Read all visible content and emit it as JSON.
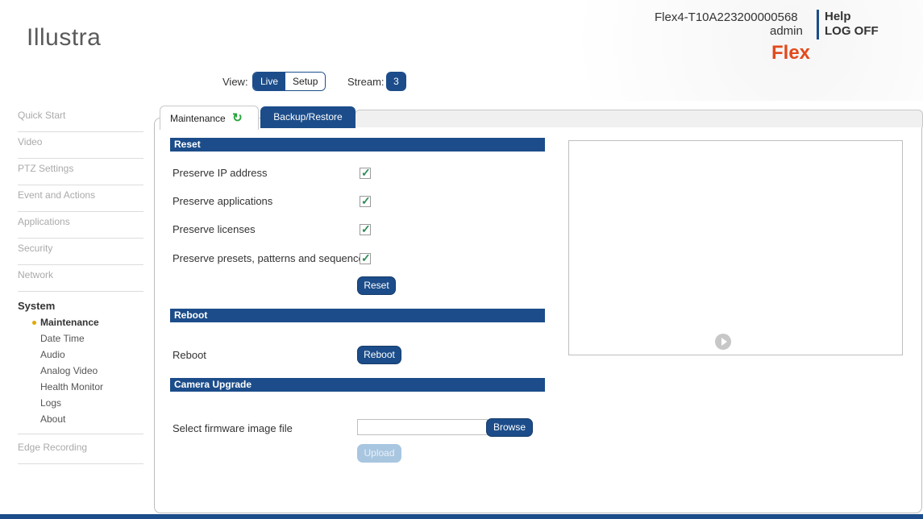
{
  "header": {
    "logo": "Illustra",
    "camera_id": "Flex4-T10A223200000568",
    "user": "admin",
    "help": "Help",
    "logoff": "LOG OFF",
    "brand": "Flex",
    "view_label": "View:",
    "view_live": "Live",
    "view_setup": "Setup",
    "stream_label": "Stream:",
    "stream_value": "3"
  },
  "sidebar": {
    "items": [
      "Quick Start",
      "Video",
      "PTZ Settings",
      "Event and Actions",
      "Applications",
      "Security",
      "Network"
    ],
    "group_title": "System",
    "sub_items": [
      "Maintenance",
      "Date Time",
      "Audio",
      "Analog Video",
      "Health Monitor",
      "Logs",
      "About"
    ],
    "after": "Edge Recording"
  },
  "tabs": {
    "maintenance": "Maintenance",
    "backup": "Backup/Restore"
  },
  "reset": {
    "title": "Reset",
    "options": [
      {
        "label": "Preserve IP address",
        "checked": true
      },
      {
        "label": "Preserve applications",
        "checked": true
      },
      {
        "label": "Preserve licenses",
        "checked": true
      },
      {
        "label": "Preserve presets, patterns and sequences",
        "checked": true
      }
    ],
    "button": "Reset"
  },
  "reboot": {
    "title": "Reboot",
    "label": "Reboot",
    "button": "Reboot"
  },
  "upgrade": {
    "title": "Camera Upgrade",
    "label": "Select firmware image file",
    "file_value": "",
    "browse": "Browse",
    "upload": "Upload"
  },
  "colors": {
    "primary": "#1c4d8a",
    "brand_orange": "#e24a1b",
    "check_green": "#2e8b57",
    "refresh_green": "#26a33a"
  }
}
